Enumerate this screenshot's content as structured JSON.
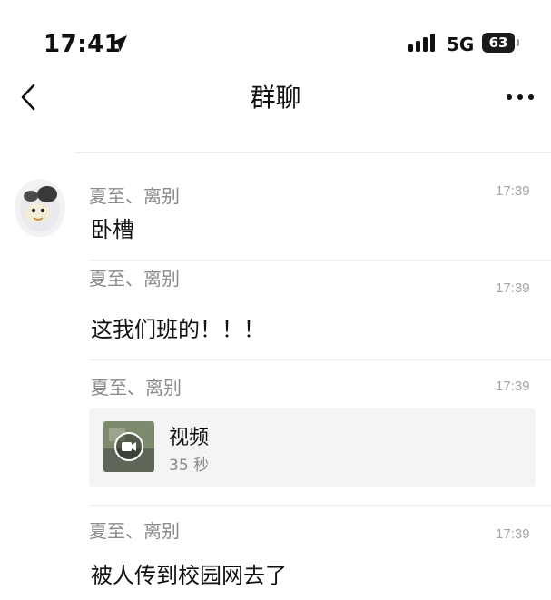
{
  "status_bar": {
    "time": "17:41",
    "network": "5G",
    "battery": "63"
  },
  "nav": {
    "title": "群聊"
  },
  "messages": [
    {
      "sender": "夏至、离别",
      "time": "17:39",
      "text": "卧槽"
    },
    {
      "sender": "夏至、离别",
      "time": "17:39",
      "text": "这我们班的！！！"
    },
    {
      "sender": "夏至、离别",
      "time": "17:39",
      "video": {
        "title": "视频",
        "duration": "35 秒"
      }
    },
    {
      "sender": "夏至、离别",
      "time": "17:39",
      "text": "被人传到校园网去了"
    }
  ]
}
